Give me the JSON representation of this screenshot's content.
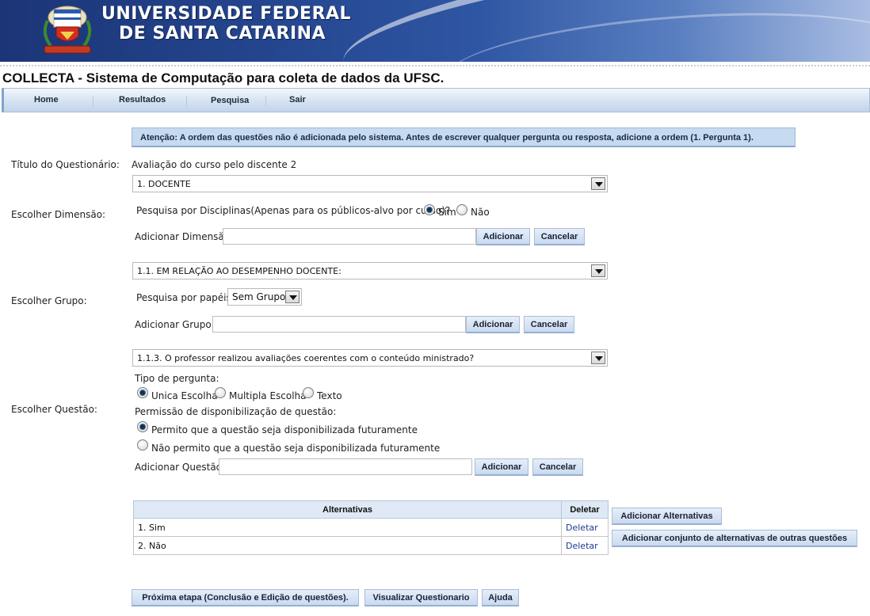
{
  "banner": {
    "line1": "UNIVERSIDADE FEDERAL",
    "line2": "DE SANTA CATARINA"
  },
  "system_title": "COLLECTA - Sistema de Computação para coleta de dados da UFSC.",
  "nav": {
    "home": "Home",
    "results": "Resultados",
    "search": "Pesquisa",
    "exit": "Sair"
  },
  "alert": "Atenção: A ordem das questões não é adicionada pelo sistema. Antes de escrever qualquer pergunta ou resposta, adicione a ordem (1. Pergunta 1).",
  "form": {
    "title_label": "Título do Questionário:",
    "title_value": "Avaliação do curso pelo discente 2",
    "dimension": {
      "label": "Escolher Dimensão:",
      "selected": "1. DOCENTE",
      "by_discipline_question": "Pesquisa por Disciplinas(Apenas para os públicos-alvo por curso)?",
      "yes": "Sim",
      "no": "Não",
      "selected_option": "yes",
      "add_label": "Adicionar Dimensão:",
      "add_value": ""
    },
    "group": {
      "label": "Escolher Grupo:",
      "selected": "1.1. EM RELAÇÃO AO DESEMPENHO DOCENTE:",
      "roles_question": "Pesquisa por papéis?",
      "roles_selected": "Sem Grupo",
      "add_label": "Adicionar Grupo:",
      "add_value": ""
    },
    "question": {
      "label": "Escolher Questão:",
      "selected": "1.1.3. O professor realizou avaliações coerentes com o conteúdo ministrado?",
      "type_label": "Tipo de pergunta:",
      "type_single": "Unica Escolha",
      "type_multiple": "Multipla Escolha",
      "type_text": "Texto",
      "type_selected": "single",
      "permission_label": "Permissão de disponibilização de questão:",
      "permission_allow": "Permito que a questão seja disponibilizada futuramente",
      "permission_deny": "Não permito que a questão seja disponibilizada futuramente",
      "permission_selected": "allow",
      "add_label": "Adicionar Questão:",
      "add_value": ""
    },
    "buttons": {
      "add": "Adicionar",
      "cancel": "Cancelar"
    }
  },
  "alternatives": {
    "headers": [
      "Alternativas",
      "Deletar"
    ],
    "rows": [
      {
        "text": "1. Sim",
        "action": "Deletar"
      },
      {
        "text": "2. Não",
        "action": "Deletar"
      }
    ],
    "add_button": "Adicionar Alternativas",
    "add_set_button": "Adicionar conjunto de alternativas de outras questões"
  },
  "footer_buttons": {
    "next": "Próxima etapa (Conclusão e Edição de questões).",
    "preview": "Visualizar Questionario",
    "help": "Ajuda"
  },
  "colors": {
    "banner_dark": "#1b3577",
    "nav_bg": "#d5e2f1",
    "button_bg": "#c9daf0",
    "alert_bg": "#c6daf0",
    "link": "#1a3c8c"
  }
}
